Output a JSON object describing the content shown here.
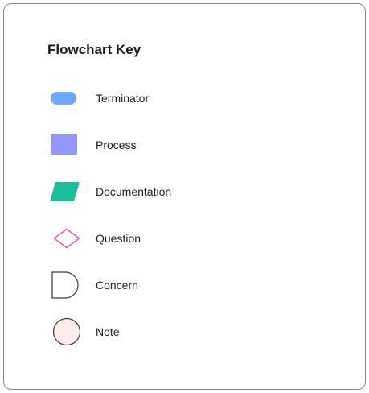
{
  "key": {
    "title": "Flowchart Key",
    "items": [
      {
        "shape": "terminator",
        "label": "Terminator",
        "fill": "#6aa9ff",
        "stroke": "none"
      },
      {
        "shape": "process",
        "label": "Process",
        "fill": "#9595ff",
        "stroke": "none"
      },
      {
        "shape": "documentation",
        "label": "Documentation",
        "fill": "#19bf9b",
        "stroke": "none"
      },
      {
        "shape": "question",
        "label": "Question",
        "fill": "#ffffff",
        "stroke": "#d94fb8"
      },
      {
        "shape": "concern",
        "label": "Concern",
        "fill": "#ffffff",
        "stroke": "#3a3a3a"
      },
      {
        "shape": "note",
        "label": "Note",
        "fill": "#fdeceb",
        "stroke": "#3a3a3a"
      }
    ]
  }
}
